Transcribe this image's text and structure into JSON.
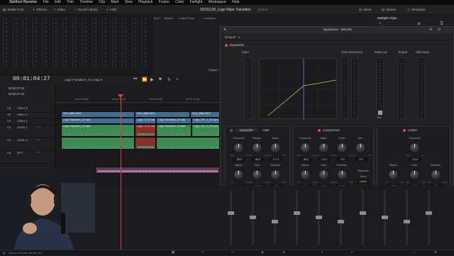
{
  "menubar": {
    "app": "DaVinci Resolve",
    "items": [
      "File",
      "Edit",
      "Trim",
      "Timeline",
      "Clip",
      "Mark",
      "View",
      "Playback",
      "Fusion",
      "Color",
      "Fairlight",
      "Workspace",
      "Help"
    ]
  },
  "toolbar": {
    "left_tabs": [
      "Media Pool",
      "Effects",
      "Index",
      "Sound Library",
      "ADR"
    ],
    "project_title": "20231128_Logo Wipe Transition",
    "project_status": "Edited",
    "right_tabs": [
      "Mixer",
      "Meters",
      "Metadata"
    ],
    "multiple_clips": "Multiple Clips"
  },
  "bus": {
    "labels": [
      "Bus 1",
      "Sidechn",
      "Control Room",
      "Loudness"
    ],
    "dims": "Dim",
    "pause": "Pause"
  },
  "dynamics": {
    "window_title": "Dynamics - MUSIC",
    "preset": "Default*",
    "section": "Dynamics",
    "input_label": "Input",
    "gain_reduction_label": "Gain Reduction",
    "makeup_label": "Make Up",
    "output_label": "Output",
    "sidechain_label": "Sidechain",
    "makeup_value": "0.0",
    "expander": {
      "tabs": [
        "Expander",
        "Gate"
      ],
      "knobs": [
        {
          "label": "Threshold",
          "value": "-35.0",
          "min": "-50.0",
          "max": "-10.0"
        },
        {
          "label": "Range",
          "value": "18.0",
          "min": "0.0",
          "max": "60.0"
        },
        {
          "label": "Ratio",
          "value": "1.1:1",
          "min": "1.1:1",
          "max": "10:1"
        },
        {
          "label": "Attack",
          "value": "1.4",
          "min": "0.5",
          "max": "100"
        },
        {
          "label": "Hold",
          "value": "0.00",
          "min": "0.00",
          "max": "4.00"
        },
        {
          "label": "Release",
          "value": "93",
          "min": "50",
          "max": "4000"
        }
      ]
    },
    "compressor": {
      "title": "Compressor",
      "knobs": [
        {
          "label": "Threshold",
          "value": "-36.2",
          "min": "-50.0",
          "max": "0.0"
        },
        {
          "label": "Ratio",
          "value": "7.0:1",
          "min": "1.1:1",
          "max": "20:1"
        },
        {
          "label": "Knee",
          "value": "0.0",
          "min": "0.0",
          "max": "6.0"
        },
        {
          "label": "Mix",
          "value": "0.0",
          "min": "0.0",
          "max": "100"
        },
        {
          "label": "Attack",
          "value": "15",
          "min": "0.5",
          "max": "100"
        },
        {
          "label": "Hold",
          "value": "429",
          "min": "0",
          "max": "4000"
        },
        {
          "label": "Release",
          "value": "1000",
          "min": "50",
          "max": "4000"
        }
      ],
      "sidechain_title": "Sidechain",
      "send_label": "Send",
      "listen_label": "Listen"
    },
    "limiter": {
      "title": "Limiter",
      "knobs": [
        {
          "label": "Threshold",
          "value": "-21.0",
          "min": "-50.0",
          "max": "0.0"
        },
        {
          "label": "Attack",
          "value": "0.71",
          "min": "0.0",
          "max": "10.0"
        },
        {
          "label": "Hold",
          "value": "0.00",
          "min": "0.00",
          "max": "4.00"
        },
        {
          "label": "Release",
          "value": "93",
          "min": "50",
          "max": "4000"
        }
      ]
    }
  },
  "timeline": {
    "timecode": "00:01:04:27",
    "name": "Logo Transition_V2 copy",
    "ruler": [
      "00:01:00:00",
      "00:01:04:00",
      "00:01:08:00",
      "00:01:12:00"
    ],
    "tracks": [
      {
        "id": "V3",
        "name": "Video 3"
      },
      {
        "id": "V2",
        "name": "Video 2"
      },
      {
        "id": "V1",
        "name": "Video 1"
      },
      {
        "id": "A1",
        "name": "Audio 1",
        "badge": "2.0"
      },
      {
        "id": "A2",
        "name": "Audio 2",
        "badge": "2.0"
      },
      {
        "id": "A3",
        "name": "SFX",
        "badge": "2.0"
      }
    ],
    "track_timecodes": [
      "00:00:07:06",
      "00:00:07:06"
    ],
    "clips_video": [
      "SKK_0862.MP4",
      "SKK_0863.MP4",
      "SKK_0862.MP4"
    ],
    "clips_v1": [
      "Logo Transition_01.mp4",
      "Logo...3_01.mp4",
      "Logo Transition_03.mp4",
      "Logo_Tra...n_02.mp4"
    ],
    "clips_audio": [
      "Logo Transition_01.mp4",
      "Logo...3_01.mp4",
      "Logo Transition_03.mp4",
      "Logo_Tra...n_02.mp4"
    ]
  },
  "status_bar": {
    "app": "DaVinci Resolve Studio 18.6"
  },
  "colors": {
    "accent_red": "#e0433b",
    "video_clip": "#3f6e92",
    "audio_clip": "#3e8a55",
    "listen_yellow": "#e8c44a"
  }
}
